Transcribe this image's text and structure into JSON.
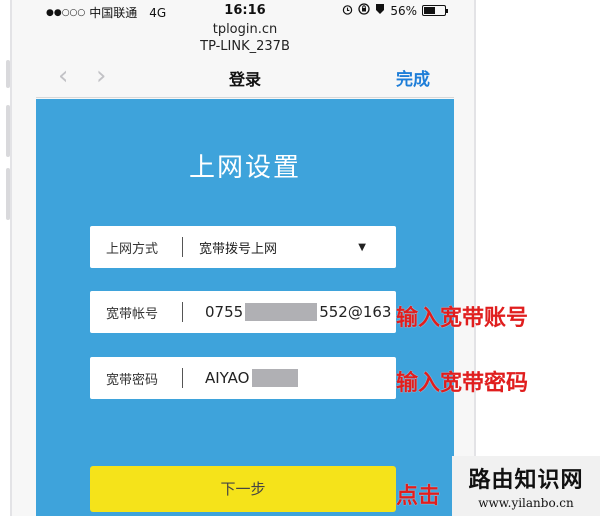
{
  "status_bar": {
    "signal": "●●○○○",
    "carrier": "中国联通",
    "network": "4G",
    "time": "16:16",
    "battery": "56%",
    "battery_level": 0.56
  },
  "browser": {
    "host": "tplogin.cn",
    "page_title": "TP-LINK_237B",
    "nav_title": "登录",
    "done_label": "完成"
  },
  "form": {
    "heading": "上网设置",
    "connection_type": {
      "label": "上网方式",
      "value": "宽带拨号上网"
    },
    "account": {
      "label": "宽带帐号",
      "value_prefix": "0755",
      "value_suffix": "552@163"
    },
    "password": {
      "label": "宽带密码",
      "value_prefix": "AIYAO"
    },
    "next_label": "下一步"
  },
  "annotations": {
    "account_hint": "输入宽带账号",
    "password_hint": "输入宽带密码",
    "click_hint": "点击"
  },
  "watermark": {
    "title": "路由知识网",
    "url": "www.yilanbo.cn"
  },
  "colors": {
    "form_bg": "#3ea3db",
    "button_bg": "#f5e31a",
    "link": "#1e7ed8",
    "annotation": "#e01e1e"
  }
}
